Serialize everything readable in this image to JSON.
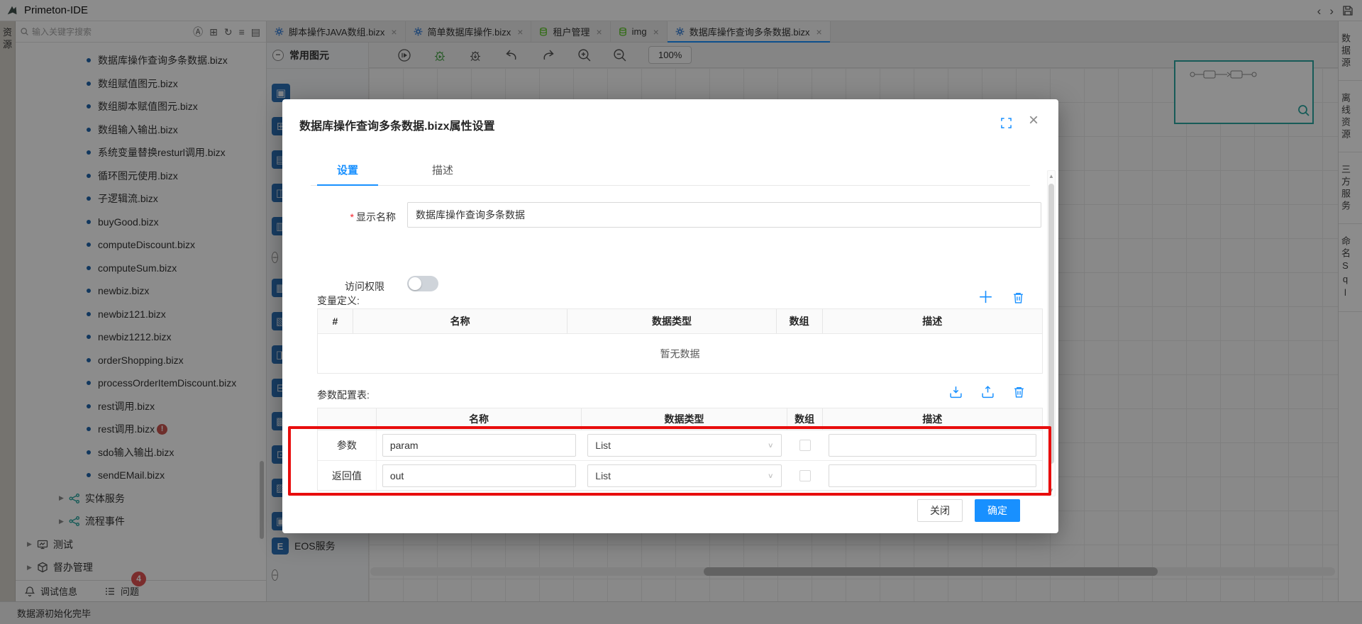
{
  "titlebar": {
    "app_title": "Primeton-IDE",
    "nav_back": "‹",
    "nav_forward": "›"
  },
  "activity_bar": {
    "label": "资源"
  },
  "sidebar": {
    "search_placeholder": "输入关键字搜索",
    "search_tools": [
      {
        "name": "ai-icon",
        "glyph": "Ⓐ"
      },
      {
        "name": "add-box-icon",
        "glyph": "⊞"
      },
      {
        "name": "refresh-icon",
        "glyph": "↻"
      },
      {
        "name": "sort-list-icon",
        "glyph": "≡"
      },
      {
        "name": "export-image-icon",
        "glyph": "▤"
      }
    ],
    "tree_items": [
      {
        "label": "数据库操作查询多条数据.bizx",
        "bullet": true,
        "level": 2
      },
      {
        "label": "数组赋值图元.bizx",
        "bullet": true,
        "level": 2
      },
      {
        "label": "数组脚本赋值图元.bizx",
        "bullet": true,
        "level": 2
      },
      {
        "label": "数组输入输出.bizx",
        "bullet": true,
        "level": 2
      },
      {
        "label": "系统变量替换resturl调用.bizx",
        "bullet": true,
        "level": 2
      },
      {
        "label": "循环图元使用.bizx",
        "bullet": true,
        "level": 2
      },
      {
        "label": "子逻辑流.bizx",
        "bullet": true,
        "level": 2
      },
      {
        "label": "buyGood.bizx",
        "bullet": true,
        "level": 2
      },
      {
        "label": "computeDiscount.bizx",
        "bullet": true,
        "level": 2
      },
      {
        "label": "computeSum.bizx",
        "bullet": true,
        "level": 2
      },
      {
        "label": "newbiz.bizx",
        "bullet": true,
        "level": 2
      },
      {
        "label": "newbiz121.bizx",
        "bullet": true,
        "level": 2
      },
      {
        "label": "newbiz1212.bizx",
        "bullet": true,
        "level": 2
      },
      {
        "label": "orderShopping.bizx",
        "bullet": true,
        "level": 2
      },
      {
        "label": "processOrderItemDiscount.bizx",
        "bullet": true,
        "level": 2
      },
      {
        "label": "rest调用.bizx",
        "bullet": true,
        "level": 2
      },
      {
        "label": "rest调用.bizx",
        "bullet": true,
        "level": 2,
        "badge": "!"
      },
      {
        "label": "sdo输入输出.bizx",
        "bullet": true,
        "level": 2
      },
      {
        "label": "sendEMail.bizx",
        "bullet": true,
        "level": 2
      },
      {
        "label": "实体服务",
        "arrow": "▶",
        "icon_net": true,
        "level": 1
      },
      {
        "label": "流程事件",
        "arrow": "▶",
        "icon_net": true,
        "level": 1
      },
      {
        "label": "测试",
        "arrow": "▶",
        "icon_test": true,
        "level": 0
      },
      {
        "label": "督办管理",
        "arrow": "▶",
        "icon_box": true,
        "level": 0
      }
    ],
    "bottom_tabs": [
      {
        "name": "debug-info-tab",
        "label": "调试信息",
        "icon_bell": true
      },
      {
        "name": "problems-tab",
        "label": "问题",
        "icon_list": true,
        "badge": "4"
      }
    ]
  },
  "editor_tabs": [
    {
      "label": "脚本操作JAVA数组.bizx",
      "icon_gear": true,
      "close": "×"
    },
    {
      "label": "简单数据库操作.bizx",
      "icon_gear": true,
      "close": "×"
    },
    {
      "label": "租户管理",
      "icon_db": true,
      "close": "×"
    },
    {
      "label": "img",
      "icon_db": true,
      "close": "×"
    },
    {
      "label": "数据库操作查询多条数据.bizx",
      "icon_gear": true,
      "close": "×",
      "active": true
    }
  ],
  "palette": {
    "header": "常用图元",
    "collapse_glyph": "−",
    "group1_icons": [
      "▣",
      "⊞",
      "▤",
      "◫",
      "▥"
    ],
    "group2_icons": [
      "▦",
      "▧",
      "◨",
      "⊟",
      "▩",
      "⊡",
      "▨",
      "▣"
    ],
    "eos_icon_letter": "E",
    "eos_label": "EOS服务"
  },
  "canvas_toolbar": {
    "zoom_level": "100%"
  },
  "right_panel": {
    "items": [
      {
        "name": "panel-tab-datasource",
        "label": "数据源"
      },
      {
        "name": "panel-tab-offline-resources",
        "label": "离线资源"
      },
      {
        "name": "panel-tab-third-party-services",
        "label": "三方服务"
      },
      {
        "name": "panel-tab-named-sql",
        "label": "命名Sql"
      }
    ]
  },
  "modal": {
    "title": "数据库操作查询多条数据.bizx属性设置",
    "tabs": [
      {
        "label": "设置",
        "active": true
      },
      {
        "label": "描述"
      }
    ],
    "form": {
      "required_mark": "*",
      "display_name_label": "显示名称",
      "display_name_value": "数据库操作查询多条数据",
      "access_label": "访问权限"
    },
    "variables": {
      "section_label": "变量定义:",
      "columns": [
        "#",
        "名称",
        "数据类型",
        "数组",
        "描述"
      ],
      "empty_text": "暂无数据"
    },
    "params": {
      "section_label": "参数配置表:",
      "columns": [
        "",
        "名称",
        "数据类型",
        "数组",
        "描述"
      ],
      "rows": [
        {
          "type": "参数",
          "name": "param",
          "datatype": "List",
          "chevron": "∨"
        },
        {
          "type": "返回值",
          "name": "out",
          "datatype": "List",
          "chevron": "∨"
        }
      ]
    },
    "footer": {
      "close_label": "关闭",
      "ok_label": "确定"
    }
  },
  "statusbar": {
    "message": "数据源初始化完毕"
  },
  "colors": {
    "accent": "#1890ff",
    "annotation_red": "#e80d0d",
    "badge_red": "#c8544f",
    "tab_green": "#52c41a",
    "minimap_teal": "#2aa7a0"
  }
}
